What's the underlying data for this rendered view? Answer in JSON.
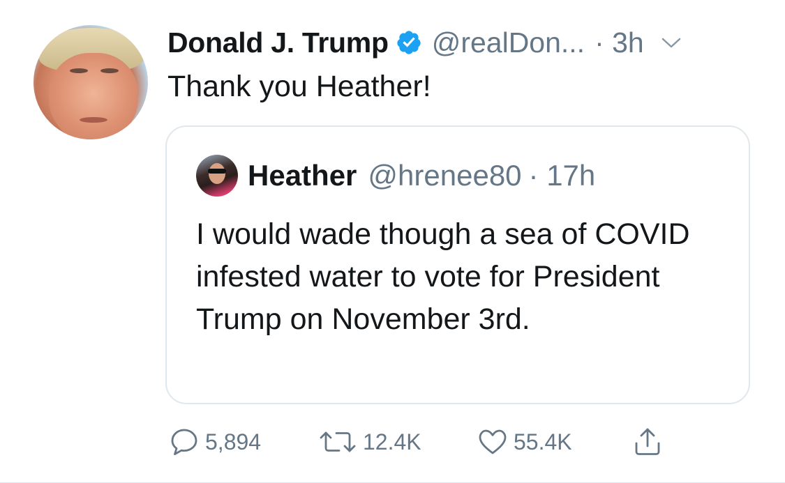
{
  "tweet": {
    "author_name": "Donald J. Trump",
    "handle": "@realDon...",
    "time": "· 3h",
    "text": "Thank you Heather!",
    "avatar_icon": "profile-photo",
    "verified_icon": "verified-badge-icon",
    "menu_icon": "chevron-down-icon"
  },
  "quote": {
    "author_name": "Heather",
    "handle": "@hrenee80",
    "time": "· 17h",
    "text": "I would wade though a sea of COVID infested water to vote for President Trump on November 3rd.",
    "avatar_icon": "profile-photo"
  },
  "actions": {
    "reply": {
      "icon": "reply-icon",
      "count": "5,894"
    },
    "retweet": {
      "icon": "retweet-icon",
      "count": "12.4K"
    },
    "like": {
      "icon": "heart-icon",
      "count": "55.4K"
    },
    "share": {
      "icon": "share-icon"
    }
  },
  "colors": {
    "text": "#14171a",
    "secondary": "#657786",
    "verified": "#1da1f2",
    "border": "#e1e8ed"
  }
}
